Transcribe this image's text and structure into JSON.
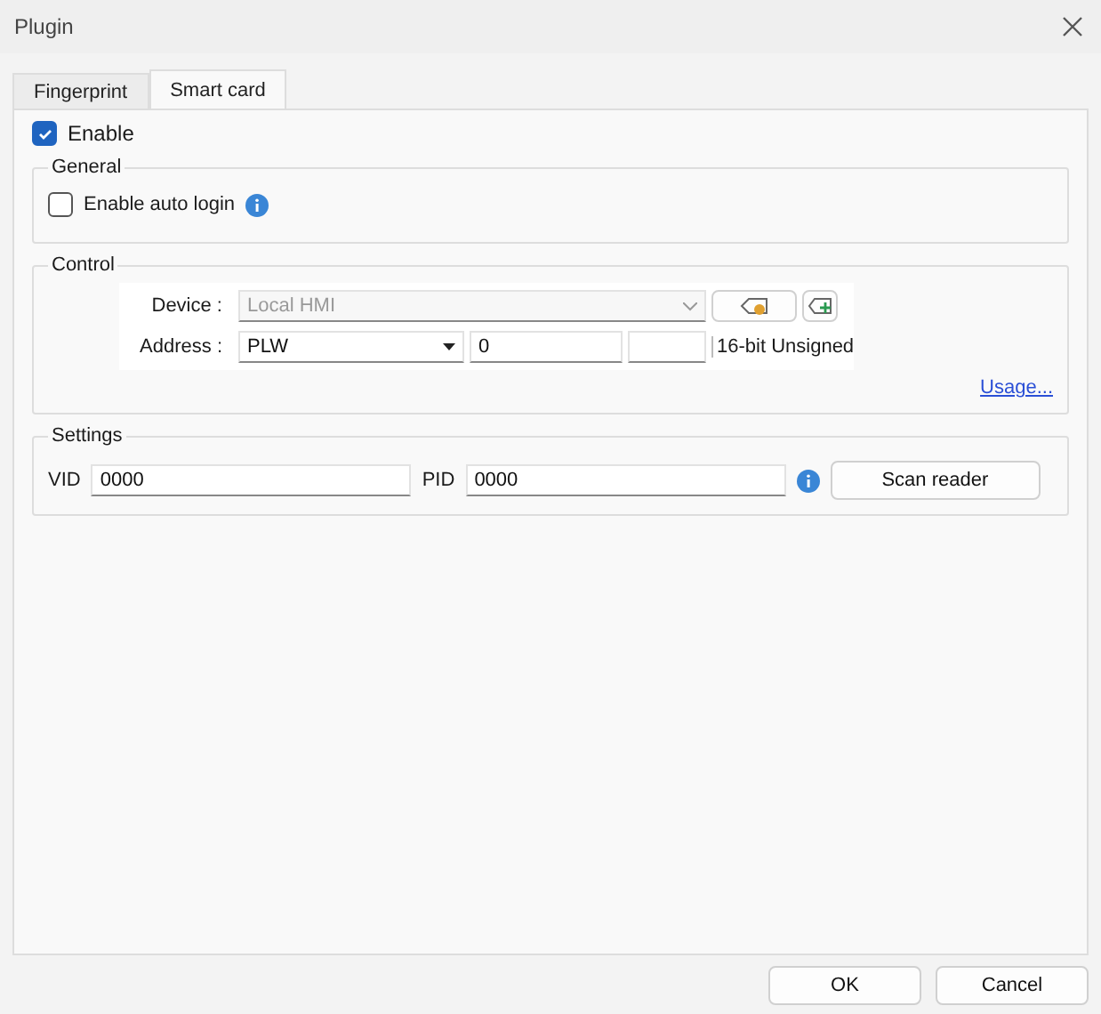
{
  "window": {
    "title": "Plugin"
  },
  "tabs": [
    {
      "label": "Fingerprint",
      "selected": false
    },
    {
      "label": "Smart card",
      "selected": true
    }
  ],
  "enable": {
    "label": "Enable",
    "checked": true
  },
  "general": {
    "title": "General",
    "auto_login": {
      "label": "Enable auto login",
      "checked": false
    }
  },
  "control": {
    "title": "Control",
    "device": {
      "label": "Device :",
      "value": "Local HMI",
      "disabled": true
    },
    "address": {
      "label": "Address :",
      "type": "PLW",
      "value": "0",
      "format": "16-bit Unsigned"
    },
    "usage_link": "Usage..."
  },
  "settings": {
    "title": "Settings",
    "vid": {
      "label": "VID",
      "value": "0000"
    },
    "pid": {
      "label": "PID",
      "value": "0000"
    },
    "scan_button": "Scan reader"
  },
  "buttons": [
    "OK",
    "Cancel"
  ]
}
